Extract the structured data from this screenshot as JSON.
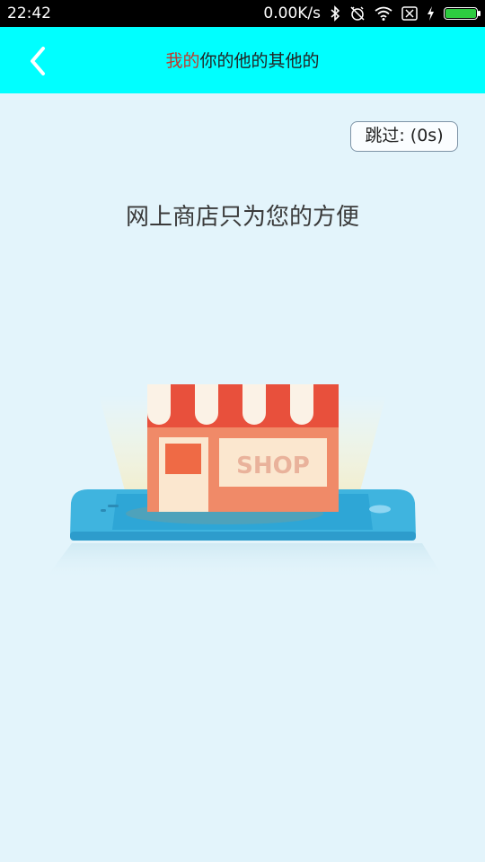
{
  "status_bar": {
    "time": "22:42",
    "net_speed": "0.00K/s",
    "battery_level": 1.0,
    "icons": [
      "bluetooth-icon",
      "alarm-off-icon",
      "wifi-icon",
      "sim-off-icon",
      "charging-icon",
      "battery-icon"
    ]
  },
  "header": {
    "back_icon": "chevron-left-icon",
    "title_highlight": "我的",
    "title_rest": "你的他的其他的"
  },
  "skip_button": {
    "label": "跳过: (0s)"
  },
  "slogan": "网上商店只为您的方便",
  "illustration": {
    "shop_sign": "SHOP"
  },
  "colors": {
    "header_bg": "#00ffff",
    "page_bg": "#e3f4fb",
    "title_highlight": "#c0392b",
    "shop_red": "#e85d4a",
    "phone_blue": "#4fc3ea"
  }
}
